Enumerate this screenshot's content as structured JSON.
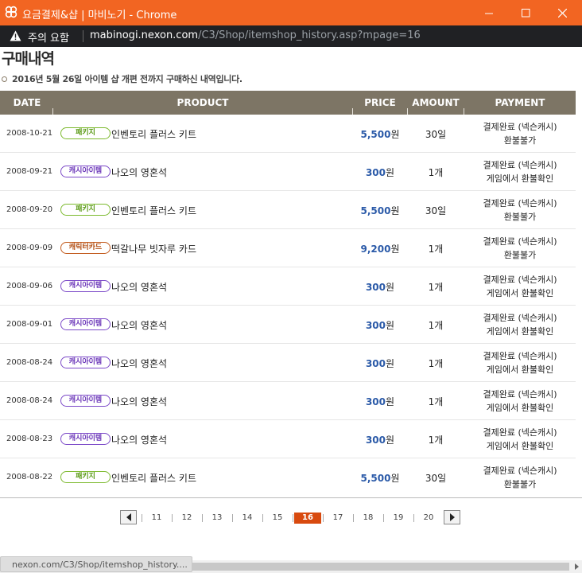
{
  "window": {
    "title": "요금결제&샵 | 마비노기 - Chrome",
    "min_icon": "minimize-icon",
    "max_icon": "maximize-icon",
    "close_icon": "close-icon",
    "accent_color": "#f26522"
  },
  "address_bar": {
    "warning_text": "주의 요함",
    "url_host": "mabinogi.nexon.com",
    "url_path": "/C3/Shop/itemshop_history.asp?mpage=16"
  },
  "page": {
    "title": "구매내역",
    "notice": "2016년 5월 26일 아이템 샵 개편 전까지 구매하신 내역입니다."
  },
  "table": {
    "headers": {
      "date": "DATE",
      "product": "PRODUCT",
      "price": "PRICE",
      "amount": "AMOUNT",
      "payment": "PAYMENT"
    },
    "rows": [
      {
        "date": "2008-10-21",
        "badge": "패키지",
        "badge_type": "package",
        "product": "인벤토리 플러스 키트",
        "price": "5,500",
        "won": "원",
        "amount": "30일",
        "pay1": "결제완료 (넥슨캐시)",
        "pay2": "환불불가"
      },
      {
        "date": "2008-09-21",
        "badge": "캐시아이템",
        "badge_type": "cash",
        "product": "나오의 영혼석",
        "price": "300",
        "won": "원",
        "amount": "1개",
        "pay1": "결제완료 (넥슨캐시)",
        "pay2": "게임에서 환불확인"
      },
      {
        "date": "2008-09-20",
        "badge": "패키지",
        "badge_type": "package",
        "product": "인벤토리 플러스 키트",
        "price": "5,500",
        "won": "원",
        "amount": "30일",
        "pay1": "결제완료 (넥슨캐시)",
        "pay2": "환불불가"
      },
      {
        "date": "2008-09-09",
        "badge": "캐릭터카드",
        "badge_type": "char",
        "product": "떡갈나무 빗자루 카드",
        "price": "9,200",
        "won": "원",
        "amount": "1개",
        "pay1": "결제완료 (넥슨캐시)",
        "pay2": "환불불가"
      },
      {
        "date": "2008-09-06",
        "badge": "캐시아이템",
        "badge_type": "cash",
        "product": "나오의 영혼석",
        "price": "300",
        "won": "원",
        "amount": "1개",
        "pay1": "결제완료 (넥슨캐시)",
        "pay2": "게임에서 환불확인"
      },
      {
        "date": "2008-09-01",
        "badge": "캐시아이템",
        "badge_type": "cash",
        "product": "나오의 영혼석",
        "price": "300",
        "won": "원",
        "amount": "1개",
        "pay1": "결제완료 (넥슨캐시)",
        "pay2": "게임에서 환불확인"
      },
      {
        "date": "2008-08-24",
        "badge": "캐시아이템",
        "badge_type": "cash",
        "product": "나오의 영혼석",
        "price": "300",
        "won": "원",
        "amount": "1개",
        "pay1": "결제완료 (넥슨캐시)",
        "pay2": "게임에서 환불확인"
      },
      {
        "date": "2008-08-24",
        "badge": "캐시아이템",
        "badge_type": "cash",
        "product": "나오의 영혼석",
        "price": "300",
        "won": "원",
        "amount": "1개",
        "pay1": "결제완료 (넥슨캐시)",
        "pay2": "게임에서 환불확인"
      },
      {
        "date": "2008-08-23",
        "badge": "캐시아이템",
        "badge_type": "cash",
        "product": "나오의 영혼석",
        "price": "300",
        "won": "원",
        "amount": "1개",
        "pay1": "결제완료 (넥슨캐시)",
        "pay2": "게임에서 환불확인"
      },
      {
        "date": "2008-08-22",
        "badge": "패키지",
        "badge_type": "package",
        "product": "인벤토리 플러스 키트",
        "price": "5,500",
        "won": "원",
        "amount": "30일",
        "pay1": "결제완료 (넥슨캐시)",
        "pay2": "환불불가"
      }
    ]
  },
  "pagination": {
    "pages": [
      "11",
      "12",
      "13",
      "14",
      "15",
      "16",
      "17",
      "18",
      "19",
      "20"
    ],
    "current": "16"
  },
  "status_bar": {
    "text": "nexon.com/C3/Shop/itemshop_history...."
  }
}
